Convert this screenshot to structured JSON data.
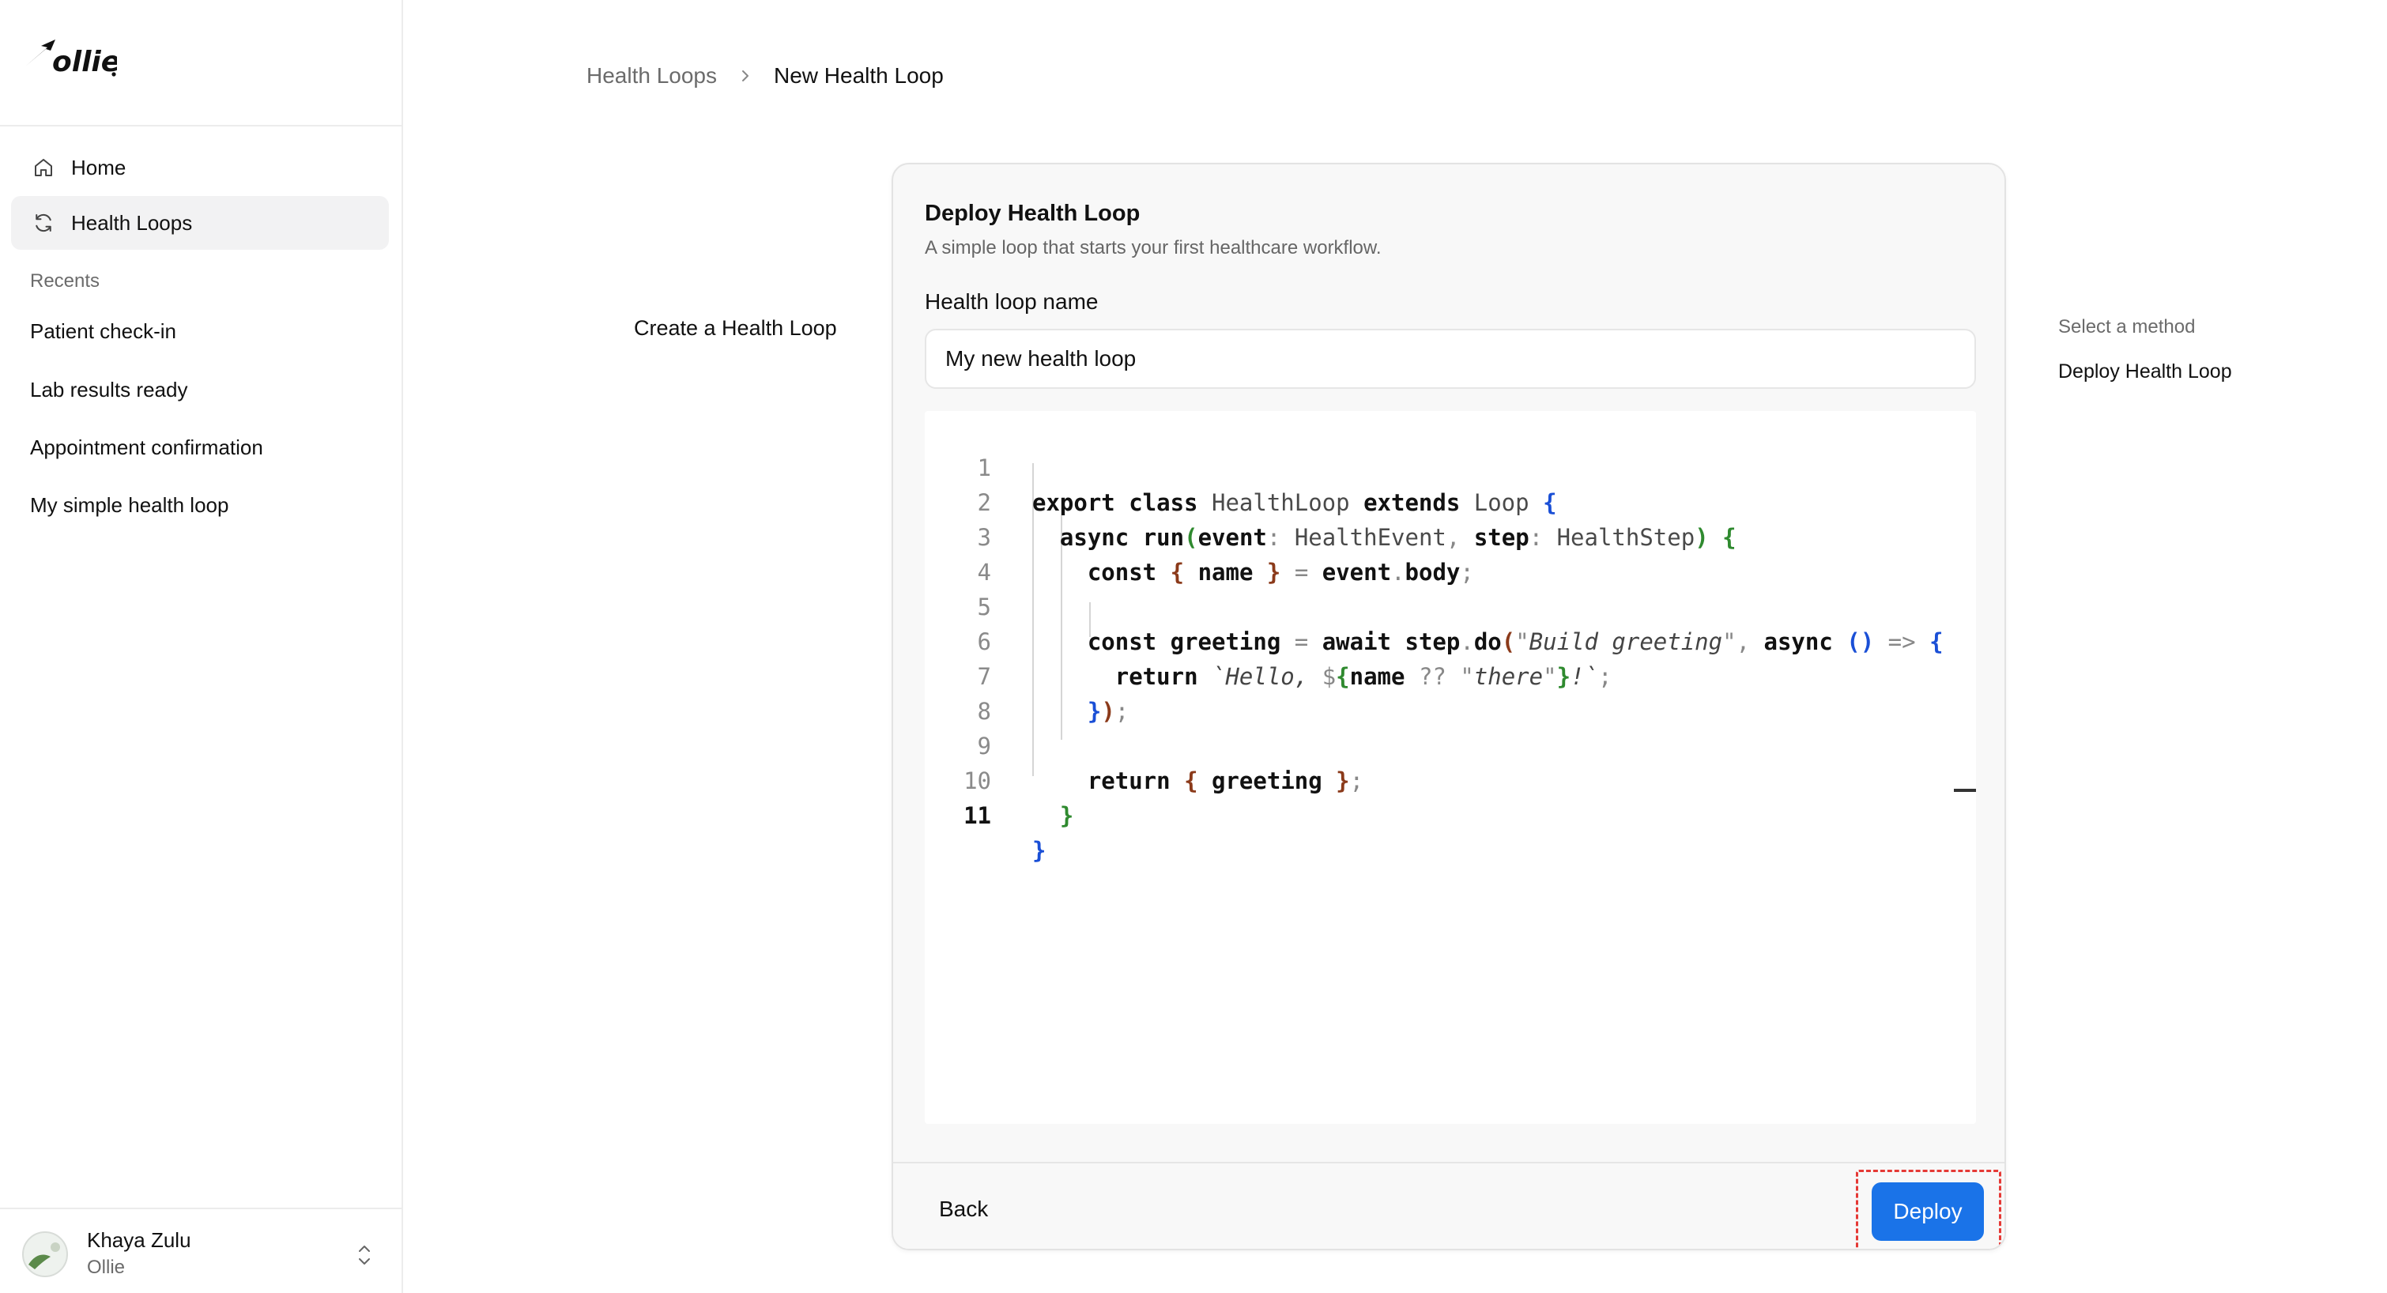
{
  "sidebar": {
    "logo_text": "ollie",
    "nav": [
      {
        "label": "Home",
        "icon": "home-icon"
      },
      {
        "label": "Health Loops",
        "icon": "refresh-icon"
      }
    ],
    "recents_label": "Recents",
    "recents": [
      "Patient check-in",
      "Lab results ready",
      "Appointment confirmation",
      "My simple health loop"
    ],
    "user": {
      "name": "Khaya Zulu",
      "org": "Ollie"
    }
  },
  "breadcrumb": {
    "parent": "Health Loops",
    "current": "New Health Loop"
  },
  "left_title": "Create a Health Loop",
  "card": {
    "title": "Deploy Health Loop",
    "description": "A simple loop that starts your first healthcare workflow.",
    "name_label": "Health loop name",
    "name_value": "My new health loop",
    "code_lines": [
      "export class HealthLoop extends Loop {",
      "  async run(event: HealthEvent, step: HealthStep) {",
      "    const { name } = event.body;",
      "",
      "    const greeting = await step.do(\"Build greeting\", async () => {",
      "      return `Hello, ${name ?? \"there\"}!`;",
      "    });",
      "",
      "    return { greeting };",
      "  }",
      "}"
    ],
    "back_label": "Back",
    "deploy_label": "Deploy"
  },
  "methods": {
    "label": "Select a method",
    "selected": "Deploy Health Loop"
  },
  "colors": {
    "accent": "#1a73e8",
    "highlight_outline": "#e53935"
  }
}
